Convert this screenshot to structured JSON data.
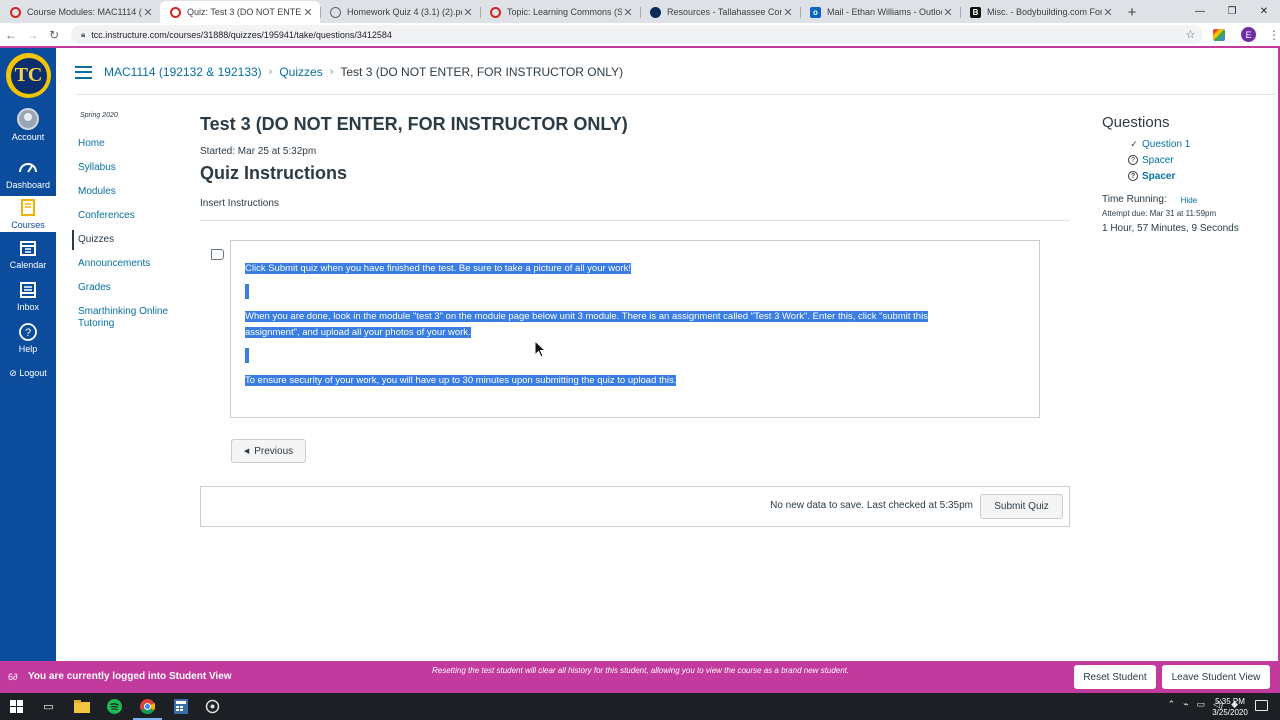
{
  "browser": {
    "tabs": [
      {
        "label": "Course Modules: MAC1114 (192",
        "icon": "canvas-icon",
        "active": false
      },
      {
        "label": "Quiz: Test 3 (DO NOT ENTER, FO",
        "icon": "canvas-icon",
        "active": true
      },
      {
        "label": "Homework Quiz 4 (3.1) (2).pdf",
        "icon": "pdf-globe-icon",
        "active": false
      },
      {
        "label": "Topic: Learning Commons (Smar",
        "icon": "canvas-icon",
        "active": false
      },
      {
        "label": "Resources - Tallahassee Commun",
        "icon": "tcc-icon",
        "active": false
      },
      {
        "label": "Mail - Ethan Williams - Outlook",
        "icon": "outlook-icon",
        "active": false
      },
      {
        "label": "Misc. - Bodybuilding.com Forum",
        "icon": "bodybuilding-icon",
        "active": false
      }
    ],
    "url": "tcc.instructure.com/courses/31888/quizzes/195941/take/questions/3412584",
    "profile_initial": "E"
  },
  "breadcrumb": {
    "course": "MAC1114 (192132 & 192133)",
    "section": "Quizzes",
    "current": "Test 3 (DO NOT ENTER, FOR INSTRUCTOR ONLY)"
  },
  "global_nav": {
    "account": "Account",
    "dashboard": "Dashboard",
    "courses": "Courses",
    "calendar": "Calendar",
    "inbox": "Inbox",
    "help": "Help",
    "logout": "Logout"
  },
  "course_nav": {
    "term": "Spring 2020",
    "items": [
      {
        "label": "Home",
        "active": false
      },
      {
        "label": "Syllabus",
        "active": false
      },
      {
        "label": "Modules",
        "active": false
      },
      {
        "label": "Conferences",
        "active": false
      },
      {
        "label": "Quizzes",
        "active": true
      },
      {
        "label": "Announcements",
        "active": false
      },
      {
        "label": "Grades",
        "active": false
      },
      {
        "label": "Smarthinking Online Tutoring",
        "active": false
      }
    ]
  },
  "quiz": {
    "title": "Test 3 (DO NOT ENTER, FOR INSTRUCTOR ONLY)",
    "started": "Started: Mar 25 at 5:32pm",
    "instructions_heading": "Quiz Instructions",
    "instructions_text": "Insert Instructions",
    "question_paragraphs": [
      "Click Submit quiz when you have finished the test. Be sure to take a picture of all your work!",
      "When you are done, look in the module \"test 3\" on the module page below unit 3 module. There is an assignment called \"Test 3 Work\". Enter this, click \"submit this",
      "assignment\", and upload all your photos of your work.",
      "To ensure security of your work, you will have up to 30 minutes upon submitting the quiz to upload this."
    ],
    "previous_label": "Previous",
    "save_status": "No new data to save. Last checked at 5:35pm",
    "submit_label": "Submit Quiz",
    "selection_color": "#3a7de3"
  },
  "sidebar": {
    "heading": "Questions",
    "questions": [
      {
        "label": "Question 1",
        "status": "answered",
        "icon": "checkmark-icon"
      },
      {
        "label": "Spacer",
        "status": "unanswered",
        "icon": "question-circle-icon"
      },
      {
        "label": "Spacer",
        "status": "current",
        "icon": "question-circle-icon"
      }
    ],
    "time_running_label": "Time Running:",
    "hide_label": "Hide",
    "attempt_due": "Attempt due: Mar 31 at 11:59pm",
    "elapsed": "1 Hour, 57 Minutes, 9 Seconds"
  },
  "student_view": {
    "message": "You are currently logged into Student View",
    "note": "Resetting the test student will clear all history for this student, allowing you to view the course as a brand new student.",
    "reset_label": "Reset Student",
    "leave_label": "Leave Student View",
    "banner_color": "#c33a9e"
  },
  "taskbar": {
    "time": "5:35 PM",
    "date": "3/25/2020"
  },
  "colors": {
    "nav_blue": "#0b4c9d",
    "link_blue": "#0770a3",
    "text": "#2d3b45"
  }
}
